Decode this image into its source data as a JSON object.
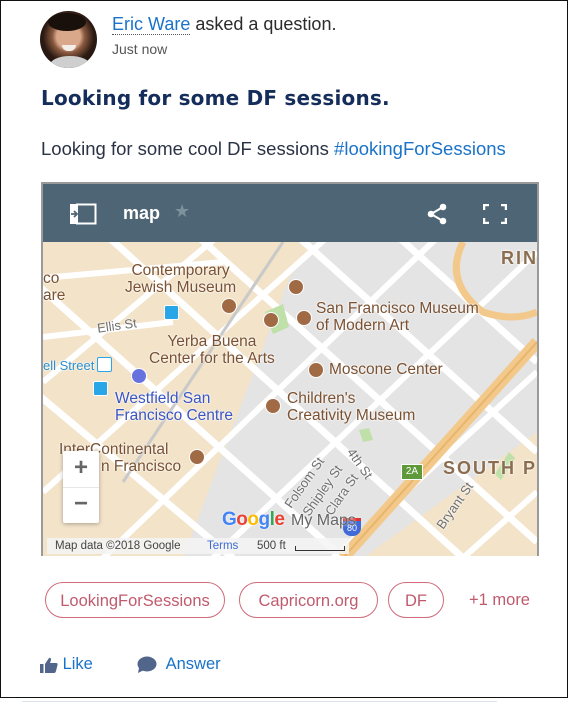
{
  "post": {
    "author": "Eric Ware",
    "action_text": "asked a question.",
    "timestamp": "Just now",
    "title": "Looking for some DF sessions.",
    "body_text": "Looking for some cool DF sessions ",
    "hashtag": "#lookingForSessions"
  },
  "map_embed": {
    "title": "map",
    "icons": {
      "panel": "side-panel-icon",
      "star": "star-icon",
      "share": "share-icon",
      "fullscreen": "fullscreen-icon"
    },
    "labels": {
      "contemporary_jewish_museum": [
        "Contemporary",
        "Jewish Museum"
      ],
      "sfmoma": [
        "San Francisco Museum",
        "of Modern Art"
      ],
      "yerba_buena": [
        "Yerba Buena",
        "Center for the Arts"
      ],
      "moscone": "Moscone Center",
      "westfield": [
        "Westfield San",
        "Francisco Centre"
      ],
      "childrens_museum": [
        "Children's",
        "Creativity Museum"
      ],
      "intercontinental": [
        "InterContinental",
        "n Francisco"
      ],
      "ellis_st": "Ellis St",
      "powell_street": "ell Street",
      "folsom_st": "Folsom St",
      "fourth_st": "4th St",
      "shipley_st": "Shipley St",
      "clara_st": "Clara St",
      "bryant_st": "Bryant St",
      "south_park": "SOUTH P",
      "rincon": "RIN",
      "left_edge_top": "co",
      "left_edge_bottom": "are",
      "exit": "2A",
      "highway": "80"
    },
    "zoom_in": "+",
    "zoom_out": "−",
    "google_logo": "Google",
    "my_maps": "My Maps",
    "attribution": "Map data ©2018 Google",
    "terms": "Terms",
    "scale": "500 ft"
  },
  "topics": {
    "items": [
      "LookingForSessions",
      "Capricorn.org",
      "DF"
    ],
    "more": "+1 more"
  },
  "actions": {
    "like": "Like",
    "answer": "Answer"
  },
  "colors": {
    "link": "#1a73c9",
    "title": "#152d5a",
    "map_header": "#4d6574",
    "topic": "#c05b6e"
  }
}
